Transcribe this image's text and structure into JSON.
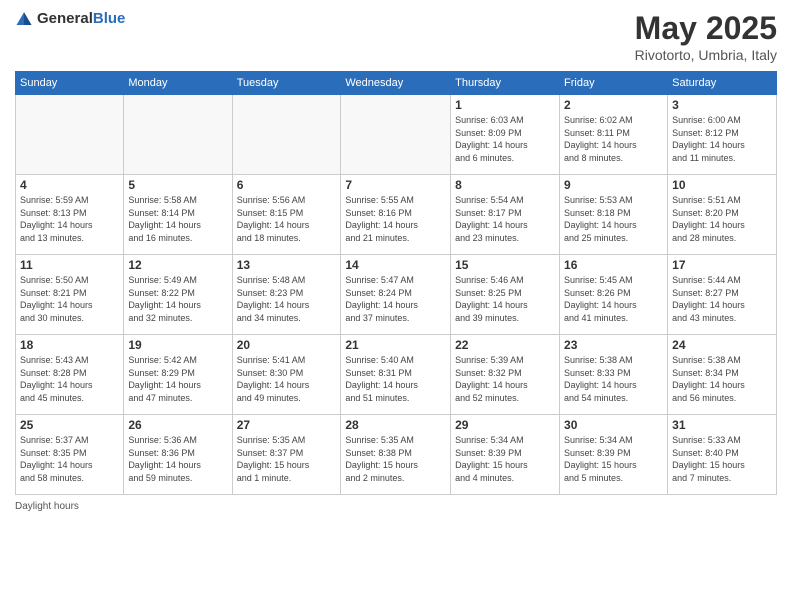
{
  "logo": {
    "general": "General",
    "blue": "Blue"
  },
  "title": {
    "month": "May 2025",
    "location": "Rivotorto, Umbria, Italy"
  },
  "weekdays": [
    "Sunday",
    "Monday",
    "Tuesday",
    "Wednesday",
    "Thursday",
    "Friday",
    "Saturday"
  ],
  "weeks": [
    [
      {
        "day": "",
        "info": ""
      },
      {
        "day": "",
        "info": ""
      },
      {
        "day": "",
        "info": ""
      },
      {
        "day": "",
        "info": ""
      },
      {
        "day": "1",
        "info": "Sunrise: 6:03 AM\nSunset: 8:09 PM\nDaylight: 14 hours\nand 6 minutes."
      },
      {
        "day": "2",
        "info": "Sunrise: 6:02 AM\nSunset: 8:11 PM\nDaylight: 14 hours\nand 8 minutes."
      },
      {
        "day": "3",
        "info": "Sunrise: 6:00 AM\nSunset: 8:12 PM\nDaylight: 14 hours\nand 11 minutes."
      }
    ],
    [
      {
        "day": "4",
        "info": "Sunrise: 5:59 AM\nSunset: 8:13 PM\nDaylight: 14 hours\nand 13 minutes."
      },
      {
        "day": "5",
        "info": "Sunrise: 5:58 AM\nSunset: 8:14 PM\nDaylight: 14 hours\nand 16 minutes."
      },
      {
        "day": "6",
        "info": "Sunrise: 5:56 AM\nSunset: 8:15 PM\nDaylight: 14 hours\nand 18 minutes."
      },
      {
        "day": "7",
        "info": "Sunrise: 5:55 AM\nSunset: 8:16 PM\nDaylight: 14 hours\nand 21 minutes."
      },
      {
        "day": "8",
        "info": "Sunrise: 5:54 AM\nSunset: 8:17 PM\nDaylight: 14 hours\nand 23 minutes."
      },
      {
        "day": "9",
        "info": "Sunrise: 5:53 AM\nSunset: 8:18 PM\nDaylight: 14 hours\nand 25 minutes."
      },
      {
        "day": "10",
        "info": "Sunrise: 5:51 AM\nSunset: 8:20 PM\nDaylight: 14 hours\nand 28 minutes."
      }
    ],
    [
      {
        "day": "11",
        "info": "Sunrise: 5:50 AM\nSunset: 8:21 PM\nDaylight: 14 hours\nand 30 minutes."
      },
      {
        "day": "12",
        "info": "Sunrise: 5:49 AM\nSunset: 8:22 PM\nDaylight: 14 hours\nand 32 minutes."
      },
      {
        "day": "13",
        "info": "Sunrise: 5:48 AM\nSunset: 8:23 PM\nDaylight: 14 hours\nand 34 minutes."
      },
      {
        "day": "14",
        "info": "Sunrise: 5:47 AM\nSunset: 8:24 PM\nDaylight: 14 hours\nand 37 minutes."
      },
      {
        "day": "15",
        "info": "Sunrise: 5:46 AM\nSunset: 8:25 PM\nDaylight: 14 hours\nand 39 minutes."
      },
      {
        "day": "16",
        "info": "Sunrise: 5:45 AM\nSunset: 8:26 PM\nDaylight: 14 hours\nand 41 minutes."
      },
      {
        "day": "17",
        "info": "Sunrise: 5:44 AM\nSunset: 8:27 PM\nDaylight: 14 hours\nand 43 minutes."
      }
    ],
    [
      {
        "day": "18",
        "info": "Sunrise: 5:43 AM\nSunset: 8:28 PM\nDaylight: 14 hours\nand 45 minutes."
      },
      {
        "day": "19",
        "info": "Sunrise: 5:42 AM\nSunset: 8:29 PM\nDaylight: 14 hours\nand 47 minutes."
      },
      {
        "day": "20",
        "info": "Sunrise: 5:41 AM\nSunset: 8:30 PM\nDaylight: 14 hours\nand 49 minutes."
      },
      {
        "day": "21",
        "info": "Sunrise: 5:40 AM\nSunset: 8:31 PM\nDaylight: 14 hours\nand 51 minutes."
      },
      {
        "day": "22",
        "info": "Sunrise: 5:39 AM\nSunset: 8:32 PM\nDaylight: 14 hours\nand 52 minutes."
      },
      {
        "day": "23",
        "info": "Sunrise: 5:38 AM\nSunset: 8:33 PM\nDaylight: 14 hours\nand 54 minutes."
      },
      {
        "day": "24",
        "info": "Sunrise: 5:38 AM\nSunset: 8:34 PM\nDaylight: 14 hours\nand 56 minutes."
      }
    ],
    [
      {
        "day": "25",
        "info": "Sunrise: 5:37 AM\nSunset: 8:35 PM\nDaylight: 14 hours\nand 58 minutes."
      },
      {
        "day": "26",
        "info": "Sunrise: 5:36 AM\nSunset: 8:36 PM\nDaylight: 14 hours\nand 59 minutes."
      },
      {
        "day": "27",
        "info": "Sunrise: 5:35 AM\nSunset: 8:37 PM\nDaylight: 15 hours\nand 1 minute."
      },
      {
        "day": "28",
        "info": "Sunrise: 5:35 AM\nSunset: 8:38 PM\nDaylight: 15 hours\nand 2 minutes."
      },
      {
        "day": "29",
        "info": "Sunrise: 5:34 AM\nSunset: 8:39 PM\nDaylight: 15 hours\nand 4 minutes."
      },
      {
        "day": "30",
        "info": "Sunrise: 5:34 AM\nSunset: 8:39 PM\nDaylight: 15 hours\nand 5 minutes."
      },
      {
        "day": "31",
        "info": "Sunrise: 5:33 AM\nSunset: 8:40 PM\nDaylight: 15 hours\nand 7 minutes."
      }
    ]
  ],
  "footer": {
    "daylight_label": "Daylight hours"
  }
}
